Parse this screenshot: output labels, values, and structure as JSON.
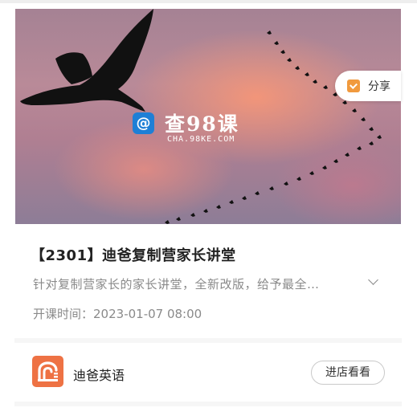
{
  "banner": {
    "watermark_title": "查98课",
    "watermark_url": "CHA.98KE.COM",
    "watermark_logo_glyph": "@",
    "colors": {
      "sky_top": "#a58294",
      "sky_glow": "#f59678",
      "silhouette": "#111111"
    }
  },
  "share": {
    "label": "分享",
    "icon": "share-icon",
    "icon_color": "#f19a3e"
  },
  "course": {
    "title": "【2301】迪爸复制营家长讲堂",
    "description": "针对复制营家长的家长讲堂，全新改版，给予最全…",
    "time_label": "开课时间：",
    "time_value": "2023-01-07 08:00"
  },
  "shop": {
    "name": "迪爸英语",
    "logo_color": "#ee7244",
    "enter_label": "进店看看"
  }
}
